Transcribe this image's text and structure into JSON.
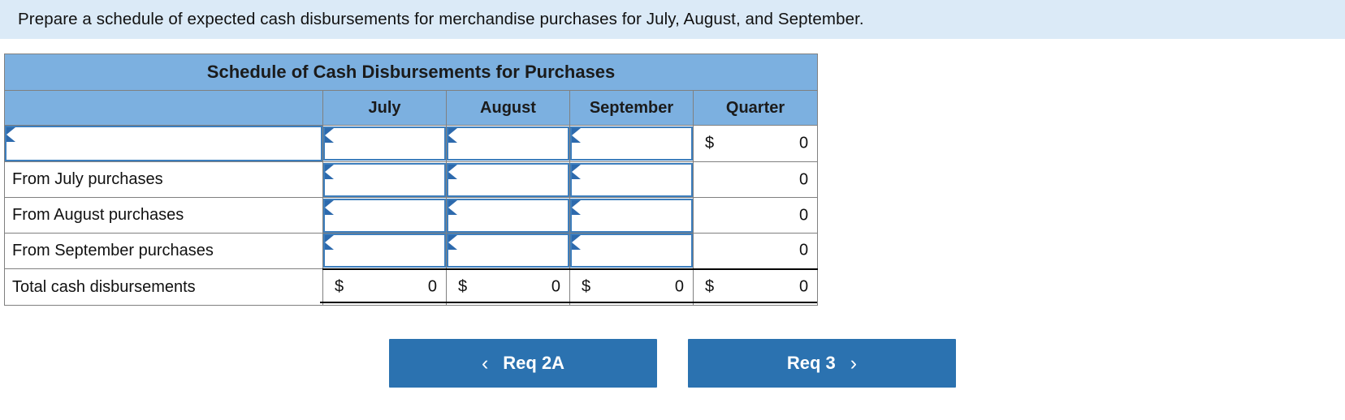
{
  "instruction": {
    "text": "Prepare a schedule of expected cash disbursements for merchandise purchases for July, August, and September."
  },
  "worksheet": {
    "title": "Schedule of Cash Disbursements for Purchases",
    "columns": {
      "label": "",
      "july": "July",
      "august": "August",
      "september": "September",
      "quarter": "Quarter"
    },
    "rows": [
      {
        "label": "",
        "label_is_input": true,
        "july": {
          "type": "input",
          "value": ""
        },
        "august": {
          "type": "input",
          "value": ""
        },
        "september": {
          "type": "input",
          "value": ""
        },
        "quarter": {
          "type": "money",
          "symbol": "$",
          "value": "0"
        }
      },
      {
        "label": "From July purchases",
        "label_is_input": false,
        "july": {
          "type": "input",
          "value": ""
        },
        "august": {
          "type": "input",
          "value": ""
        },
        "september": {
          "type": "input",
          "value": ""
        },
        "quarter": {
          "type": "money",
          "symbol": "",
          "value": "0"
        }
      },
      {
        "label": "From August purchases",
        "label_is_input": false,
        "july": {
          "type": "input",
          "value": ""
        },
        "august": {
          "type": "input",
          "value": ""
        },
        "september": {
          "type": "input",
          "value": ""
        },
        "quarter": {
          "type": "money",
          "symbol": "",
          "value": "0"
        }
      },
      {
        "label": "From September purchases",
        "label_is_input": false,
        "july": {
          "type": "input",
          "value": ""
        },
        "august": {
          "type": "input",
          "value": ""
        },
        "september": {
          "type": "input",
          "value": ""
        },
        "quarter": {
          "type": "money",
          "symbol": "",
          "value": "0"
        }
      }
    ],
    "total_row": {
      "label": "Total cash disbursements",
      "july": {
        "symbol": "$",
        "value": "0"
      },
      "august": {
        "symbol": "$",
        "value": "0"
      },
      "september": {
        "symbol": "$",
        "value": "0"
      },
      "quarter": {
        "symbol": "$",
        "value": "0"
      }
    }
  },
  "navigation": {
    "prev": {
      "label": "Req 2A",
      "chevron": "‹"
    },
    "next": {
      "label": "Req 3",
      "chevron": "›"
    }
  },
  "colors": {
    "banner_bg": "#dbeaf7",
    "header_bg": "#7cb0e0",
    "input_border": "#3d7ebd",
    "flag": "#2d6aad",
    "button_bg": "#2b72b0",
    "grid": "#808080"
  }
}
